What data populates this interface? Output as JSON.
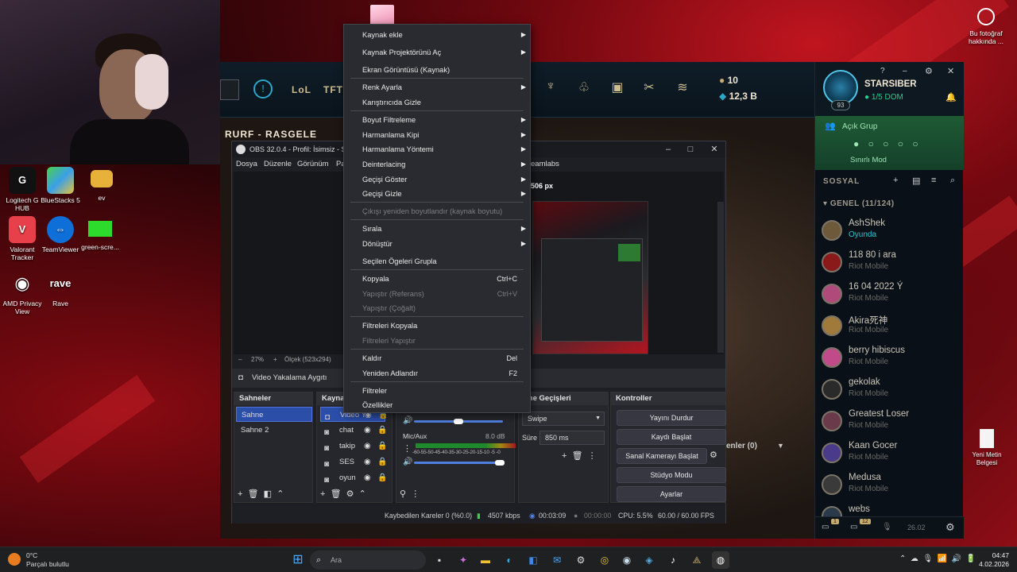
{
  "desktop": {
    "icons": [
      {
        "label": "Logitech G HUB",
        "icon": "logitech-g-icon"
      },
      {
        "label": "BlueStacks 5",
        "icon": "bluestacks-icon"
      },
      {
        "label": "ev",
        "icon": "folder-icon"
      },
      {
        "label": "Valorant Tracker",
        "icon": "valorant-tracker-icon"
      },
      {
        "label": "TeamViewer",
        "icon": "teamviewer-icon"
      },
      {
        "label": "green-scre...",
        "icon": "image-icon"
      },
      {
        "label": "AMD Privacy View",
        "icon": "amd-privacy-icon"
      },
      {
        "label": "Rave",
        "icon": "rave-icon"
      }
    ],
    "photo_info": "Bu fotoğraf hakkında ...",
    "new_doc": "Yeni Metin Belgesi"
  },
  "lol": {
    "tabs": [
      "LoL",
      "TFT"
    ],
    "mode_title": "RURF - RASGELE",
    "currency": {
      "rp": "10",
      "be": "12,3 B"
    },
    "profile": {
      "name": "STARSIBER",
      "level": "93",
      "status": "1/5 DOM"
    },
    "group": {
      "title": "Açık Grup",
      "mode": "Sınırlı Mod"
    },
    "social_header": "SOSYAL",
    "friends_header": "GENEL (11/124)",
    "friends": [
      {
        "name": "AshShek",
        "status": "Oyunda",
        "playing": true,
        "color": "#6e5a3a"
      },
      {
        "name": "118 80 i ara",
        "status": "Riot Mobile",
        "playing": false,
        "color": "#8a1a1a"
      },
      {
        "name": "16 04 2022 Ý",
        "status": "Riot Mobile",
        "playing": false,
        "color": "#b04a7a"
      },
      {
        "name": "Akira死神",
        "status": "Riot Mobile",
        "playing": false,
        "color": "#a07a3a"
      },
      {
        "name": "berry hibiscus",
        "status": "Riot Mobile",
        "playing": false,
        "color": "#c04a8a"
      },
      {
        "name": "gekolak",
        "status": "Riot Mobile",
        "playing": false,
        "color": "#2a2a2a"
      },
      {
        "name": "Greatest Loser",
        "status": "Riot Mobile",
        "playing": false,
        "color": "#6a3a4a"
      },
      {
        "name": "Kaan Gocer",
        "status": "Riot Mobile",
        "playing": false,
        "color": "#4a3a8a"
      },
      {
        "name": "Medusa",
        "status": "Riot Mobile",
        "playing": false,
        "color": "#3a3a3a"
      },
      {
        "name": "webs",
        "status": "",
        "playing": false,
        "color": "#2a3a4a"
      }
    ],
    "bottom_badges": [
      "1",
      "12"
    ],
    "bottom_time": "26.02"
  },
  "obs": {
    "title": "OBS 32.0.4 - Profil: İsimsiz - Sahne",
    "menus": [
      "Dosya",
      "Düzenle",
      "Görünüm",
      "Pa",
      "eamlabs"
    ],
    "preview_label": "506 px",
    "zoom": "27%",
    "scale_text": "Ölçek (523x294)",
    "source_bar": "Video Yakalama Aygıtı",
    "docks": {
      "scenes": "Sahneler",
      "sources": "Kaynak",
      "transitions": "hne Geçişleri",
      "controls": "Kontroller"
    },
    "scenes": [
      "Sahne",
      "Sahne 2"
    ],
    "sources": [
      "Video Y",
      "chat",
      "takip",
      "SES",
      "oyun"
    ],
    "mixer": {
      "mic_label": "Mic/Aux",
      "mic_db": "8.0 dB",
      "scale": "-60-55-50-45-40-35-30-25-20-15-10 -5 -0"
    },
    "transition": {
      "type": "Swipe",
      "duration_label": "Süre",
      "duration": "850 ms"
    },
    "controls": [
      "Yayını Durdur",
      "Kaydı Başlat",
      "Sanal Kamerayı Başlat",
      "Stüdyo Modu",
      "Ayarlar"
    ],
    "extra_dock": "enler (0)",
    "status": {
      "dropped": "Kaybedilen Kareler 0 (%0.0)",
      "bitrate": "4507 kbps",
      "stream_time": "00:03:09",
      "rec_time": "00:00:00",
      "cpu": "CPU: 5.5%",
      "fps": "60.00 / 60.00 FPS"
    }
  },
  "context_menu": {
    "items": [
      {
        "label": "Kaynak ekle",
        "submenu": true,
        "disabled": false,
        "shortcut": ""
      },
      {
        "label": "Kaynak Projektörünü Aç",
        "submenu": true,
        "disabled": false,
        "shortcut": ""
      },
      {
        "label": "Ekran Görüntüsü (Kaynak)",
        "submenu": false,
        "disabled": false,
        "shortcut": ""
      },
      {
        "label": "Renk Ayarla",
        "submenu": true,
        "disabled": false,
        "shortcut": ""
      },
      {
        "label": "Karıştırıcıda Gizle",
        "submenu": false,
        "disabled": false,
        "shortcut": ""
      },
      {
        "label": "Boyut Filtreleme",
        "submenu": true,
        "disabled": false,
        "shortcut": ""
      },
      {
        "label": "Harmanlama Kipi",
        "submenu": true,
        "disabled": false,
        "shortcut": ""
      },
      {
        "label": "Harmanlama Yöntemi",
        "submenu": true,
        "disabled": false,
        "shortcut": ""
      },
      {
        "label": "Deinterlacing",
        "submenu": true,
        "disabled": false,
        "shortcut": ""
      },
      {
        "label": "Geçişi Göster",
        "submenu": true,
        "disabled": false,
        "shortcut": ""
      },
      {
        "label": "Geçişi Gizle",
        "submenu": true,
        "disabled": false,
        "shortcut": ""
      },
      {
        "label": "Çıkışı yeniden boyutlandır (kaynak boyutu)",
        "submenu": false,
        "disabled": true,
        "shortcut": ""
      },
      {
        "label": "Sırala",
        "submenu": true,
        "disabled": false,
        "shortcut": ""
      },
      {
        "label": "Dönüştür",
        "submenu": true,
        "disabled": false,
        "shortcut": ""
      },
      {
        "label": "Seçilen Ögeleri Grupla",
        "submenu": false,
        "disabled": false,
        "shortcut": ""
      },
      {
        "label": "Kopyala",
        "submenu": false,
        "disabled": false,
        "shortcut": "Ctrl+C"
      },
      {
        "label": "Yapıştır (Referans)",
        "submenu": false,
        "disabled": true,
        "shortcut": "Ctrl+V"
      },
      {
        "label": "Yapıştır (Çoğalt)",
        "submenu": false,
        "disabled": true,
        "shortcut": ""
      },
      {
        "label": "Filtreleri Kopyala",
        "submenu": false,
        "disabled": false,
        "shortcut": ""
      },
      {
        "label": "Filtreleri Yapıştır",
        "submenu": false,
        "disabled": true,
        "shortcut": ""
      },
      {
        "label": "Kaldır",
        "submenu": false,
        "disabled": false,
        "shortcut": "Del"
      },
      {
        "label": "Yeniden Adlandır",
        "submenu": false,
        "disabled": false,
        "shortcut": "F2"
      },
      {
        "label": "Filtreler",
        "submenu": false,
        "disabled": false,
        "shortcut": ""
      },
      {
        "label": "Özellikler",
        "submenu": false,
        "disabled": false,
        "shortcut": ""
      }
    ]
  },
  "taskbar": {
    "weather_temp": "0°C",
    "weather_desc": "Parçalı bulutlu",
    "search_placeholder": "Ara",
    "time": "04:47",
    "date": "4.02.2026"
  },
  "colors": {
    "accent": "#2b4ea8",
    "lol_gold": "#cdbe91",
    "wallpaper_red": "#c0151f",
    "status_green": "#1ed38a"
  }
}
